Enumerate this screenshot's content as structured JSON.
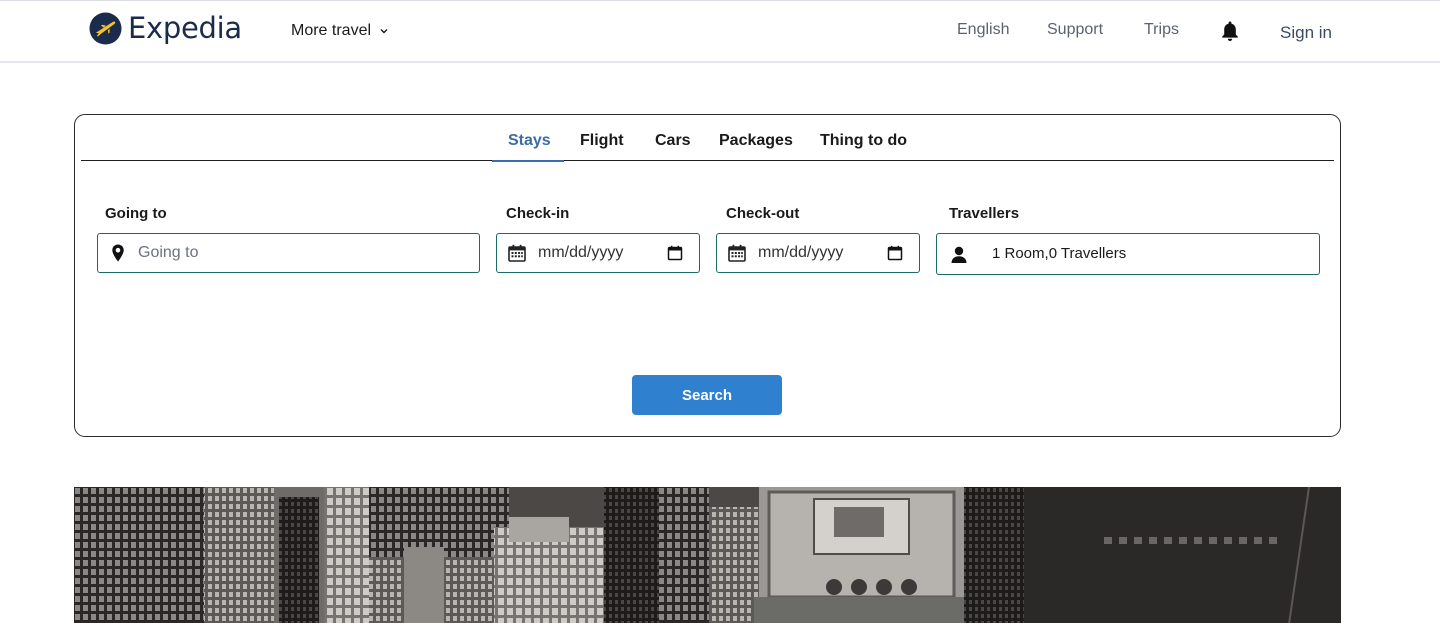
{
  "header": {
    "logo_text": "Expedia",
    "logo_icon": "expedia-plane-logo",
    "more_travel_label": "More travel",
    "nav": {
      "english": "English",
      "support": "Support",
      "trips": "Trips"
    },
    "bell_icon": "notification-bell-icon",
    "sign_in": "Sign in"
  },
  "search": {
    "tabs": [
      {
        "label": "Stays",
        "active": true
      },
      {
        "label": "Flight",
        "active": false
      },
      {
        "label": "Cars",
        "active": false
      },
      {
        "label": "Packages",
        "active": false
      },
      {
        "label": "Thing to do",
        "active": false
      }
    ],
    "going_to": {
      "label": "Going to",
      "placeholder": "Going to",
      "value": ""
    },
    "check_in": {
      "label": "Check-in",
      "placeholder": "mm/dd/yyyy"
    },
    "check_out": {
      "label": "Check-out",
      "placeholder": "mm/dd/yyyy"
    },
    "travellers": {
      "label": "Travellers",
      "value": "1 Room,0 Travellers"
    },
    "button_label": "Search"
  },
  "colors": {
    "accent": "#3b6ca8",
    "button": "#2f80ce",
    "field_border": "#1c6b64",
    "logo_yellow": "#f6c12e",
    "logo_navy": "#1b2b4b"
  }
}
